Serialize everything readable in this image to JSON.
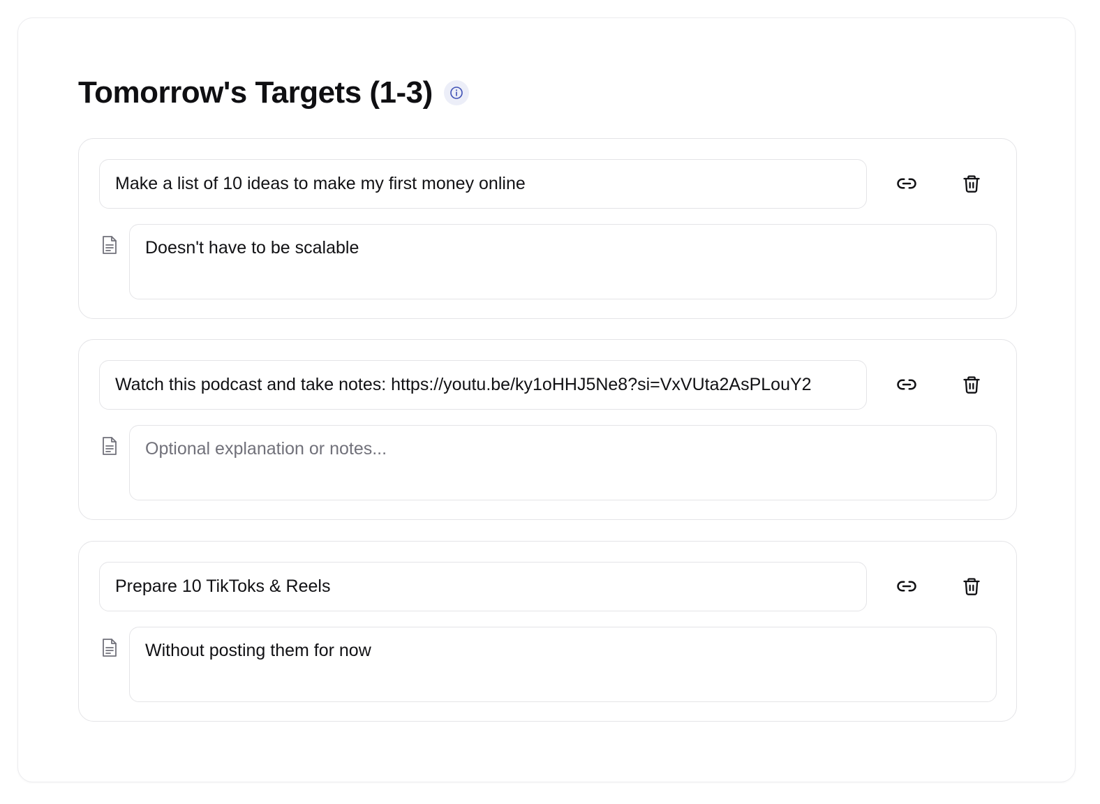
{
  "header": {
    "title": "Tomorrow's Targets (1-3)",
    "info_icon": "info-icon"
  },
  "colors": {
    "accent": "#3f51b5",
    "info_bg": "#eceef8",
    "border": "#e4e4e7",
    "placeholder": "#71717a"
  },
  "targets": [
    {
      "title": "Make a list of 10 ideas to make my first money online",
      "notes": "Doesn't have to be scalable",
      "notes_placeholder": "Optional explanation or notes..."
    },
    {
      "title": "Watch this podcast and take notes: https://youtu.be/ky1oHHJ5Ne8?si=VxVUta2AsPLouY2",
      "notes": "",
      "notes_placeholder": "Optional explanation or notes..."
    },
    {
      "title": "Prepare 10 TikToks & Reels",
      "notes": "Without posting them for now",
      "notes_placeholder": "Optional explanation or notes..."
    }
  ],
  "icons": {
    "link": "link-icon",
    "delete": "trash-icon",
    "notes": "document-icon"
  }
}
